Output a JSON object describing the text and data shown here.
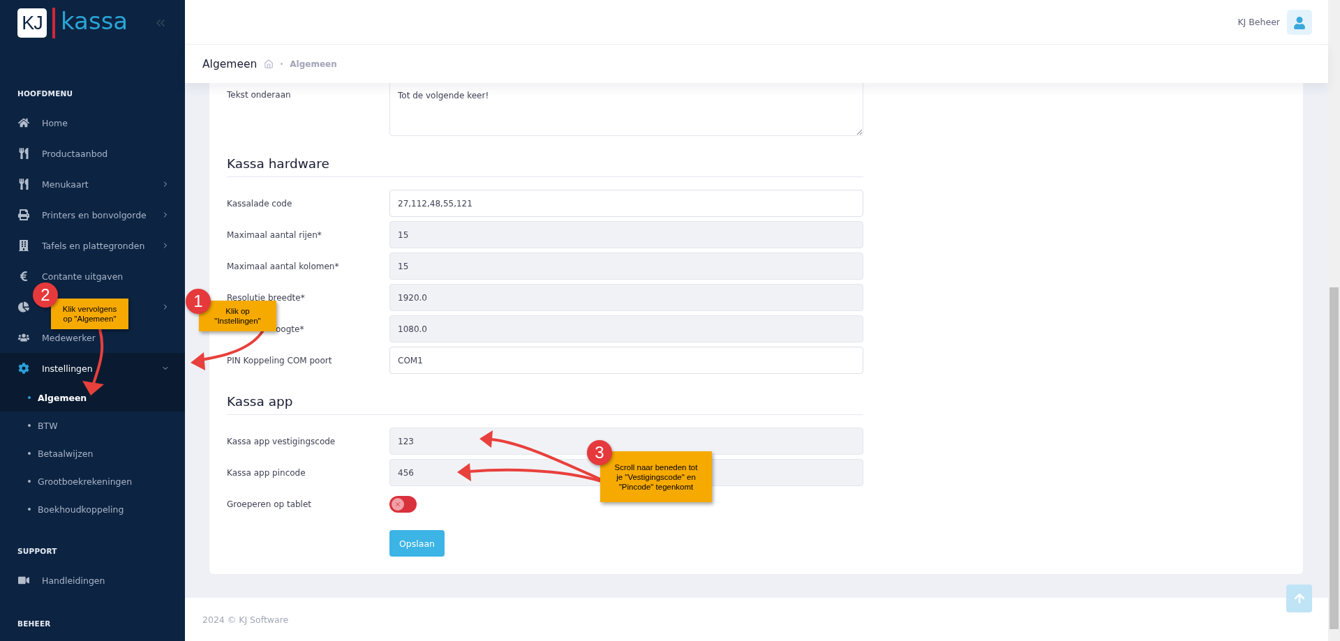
{
  "logo": {
    "badge": "KJ",
    "name": "kassa"
  },
  "user": {
    "name": "KJ Beheer"
  },
  "breadcrumb": {
    "title": "Algemeen",
    "trail": "Algemeen"
  },
  "sidebar": {
    "sections": [
      {
        "heading": "HOOFDMENU",
        "items": [
          {
            "label": "Home",
            "submenu": false,
            "selected": false
          },
          {
            "label": "Productaanbod",
            "submenu": false,
            "selected": false
          },
          {
            "label": "Menukaart",
            "submenu": true,
            "expanded": false,
            "selected": false
          },
          {
            "label": "Printers en bonvolgorde",
            "submenu": true,
            "expanded": false,
            "selected": false
          },
          {
            "label": "Tafels en plattegronden",
            "submenu": true,
            "expanded": false,
            "selected": false
          },
          {
            "label": "Contante uitgaven",
            "submenu": false,
            "selected": false
          },
          {
            "submenu": true,
            "expanded": false,
            "selected": false
          },
          {
            "label": "Medewerker",
            "submenu": false,
            "selected": false
          },
          {
            "label": "Instellingen",
            "submenu": true,
            "expanded": true,
            "selected": true,
            "children": [
              {
                "label": "Algemeen",
                "selected": true
              },
              {
                "label": "BTW",
                "selected": false
              },
              {
                "label": "Betaalwijzen",
                "selected": false
              },
              {
                "label": "Grootboekrekeningen",
                "selected": false
              },
              {
                "label": "Boekhoudkoppeling",
                "selected": false
              }
            ]
          }
        ]
      },
      {
        "heading": "SUPPORT",
        "items": [
          {
            "label": "Handleidingen",
            "submenu": false,
            "selected": false
          }
        ]
      },
      {
        "heading": "BEHEER"
      }
    ]
  },
  "form": {
    "top_rows": [
      {
        "kind": "textarea",
        "label": "Tekst onderaan",
        "value": "Tot de volgende keer!"
      }
    ],
    "sections": [
      {
        "heading": "Kassa hardware",
        "rows": [
          {
            "kind": "input",
            "label": "Kassalade code",
            "value": "27,112,48,55,121",
            "readonly": false
          },
          {
            "kind": "input",
            "label": "Maximaal aantal rijen*",
            "value": "15",
            "readonly": true
          },
          {
            "kind": "input",
            "label": "Maximaal aantal kolomen*",
            "value": "15",
            "readonly": true
          },
          {
            "kind": "input",
            "label": "Resolutie breedte*",
            "value": "1920.0",
            "readonly": true
          },
          {
            "kind": "input",
            "label": "oogte*",
            "value": "1080.0",
            "readonly": true,
            "partly_hidden": true
          },
          {
            "kind": "input",
            "label": "PIN Koppeling COM poort",
            "value": "COM1",
            "readonly": false
          }
        ]
      },
      {
        "heading": "Kassa app",
        "rows": [
          {
            "kind": "input",
            "label": "Kassa app vestigingscode",
            "value": "123",
            "readonly": true
          },
          {
            "kind": "input",
            "label": "Kassa app pincode",
            "value": "456",
            "readonly": true
          },
          {
            "kind": "toggle",
            "label": "Groeperen op tablet",
            "on": false
          }
        ]
      }
    ],
    "save_button": "Opslaan"
  },
  "footer": "2024 © KJ Software",
  "annotations": [
    {
      "number": "2",
      "text": "Klik vervolgens\nop \"Algemeen\""
    },
    {
      "number": "1",
      "text": "Klik op\n\"Instellingen\""
    },
    {
      "number": "3",
      "text": "Scroll naar beneden tot\nje \"Vestigingscode\" en\n\"Pincode\" tegenkomt"
    }
  ]
}
